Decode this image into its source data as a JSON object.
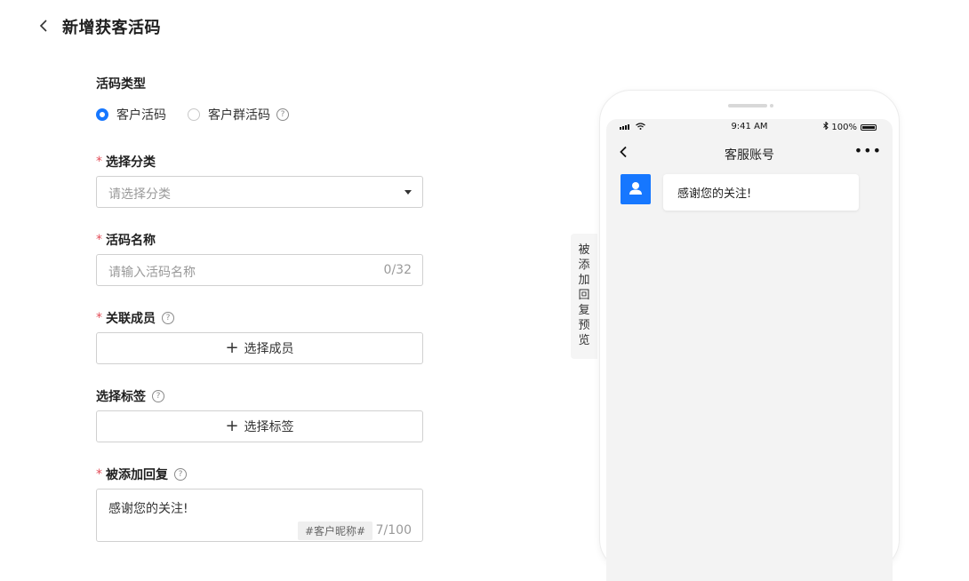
{
  "header": {
    "title": "新增获客活码"
  },
  "type_section": {
    "label": "活码类型",
    "options": [
      {
        "label": "客户活码",
        "selected": true
      },
      {
        "label": "客户群活码",
        "selected": false
      }
    ]
  },
  "category": {
    "required_mark": "*",
    "label": "选择分类",
    "placeholder": "请选择分类"
  },
  "name": {
    "required_mark": "*",
    "label": "活码名称",
    "placeholder": "请输入活码名称",
    "count": "0/32"
  },
  "members": {
    "required_mark": "*",
    "label": "关联成员",
    "button_label": "选择成员"
  },
  "tags": {
    "label": "选择标签",
    "button_label": "选择标签"
  },
  "reply": {
    "required_mark": "*",
    "label": "被添加回复",
    "value": "感谢您的关注!",
    "chip": "#客户昵称#",
    "count": "7/100"
  },
  "preview_tab": {
    "chars": [
      "被",
      "添",
      "加",
      "回",
      "复",
      "预",
      "览"
    ]
  },
  "phone": {
    "time": "9:41 AM",
    "battery": "100%",
    "title": "客服账号",
    "message": "感谢您的关注!"
  },
  "colors": {
    "accent": "#1677ff",
    "required": "#e34d59"
  }
}
